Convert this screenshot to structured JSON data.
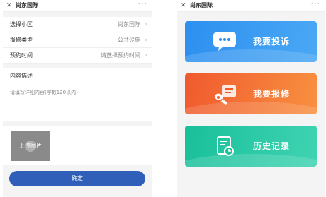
{
  "left": {
    "topbar": {
      "close": "✕",
      "title": "尚东国际",
      "more": "···"
    },
    "rows": [
      {
        "label": "选择小区",
        "value": "尚东国际",
        "chevron": "›"
      },
      {
        "label": "报修类型",
        "value": "公共设施",
        "chevron": "›"
      },
      {
        "label": "预约时间",
        "value": "请选择预约时间",
        "chevron": "›"
      }
    ],
    "description": {
      "title": "内容描述",
      "placeholder": "请填写详细内容(字数120以内)"
    },
    "upload_label": "上传图片",
    "confirm_label": "确定"
  },
  "right": {
    "topbar": {
      "close": "✕",
      "title": "尚东国际",
      "more": "···"
    },
    "cards": [
      {
        "label": "我要投诉",
        "icon": "chat-bubble-icon",
        "colors": [
          "#2d8ff0",
          "#4aa8f4"
        ]
      },
      {
        "label": "我要报修",
        "icon": "wrench-icon",
        "colors": [
          "#f05a2e",
          "#f89040"
        ]
      },
      {
        "label": "历史记录",
        "icon": "history-document-icon",
        "colors": [
          "#19c09a",
          "#3fd3b2"
        ]
      }
    ]
  },
  "colors": {
    "confirm_button": "#2f5fb8",
    "page_background": "#f4f4f4"
  }
}
